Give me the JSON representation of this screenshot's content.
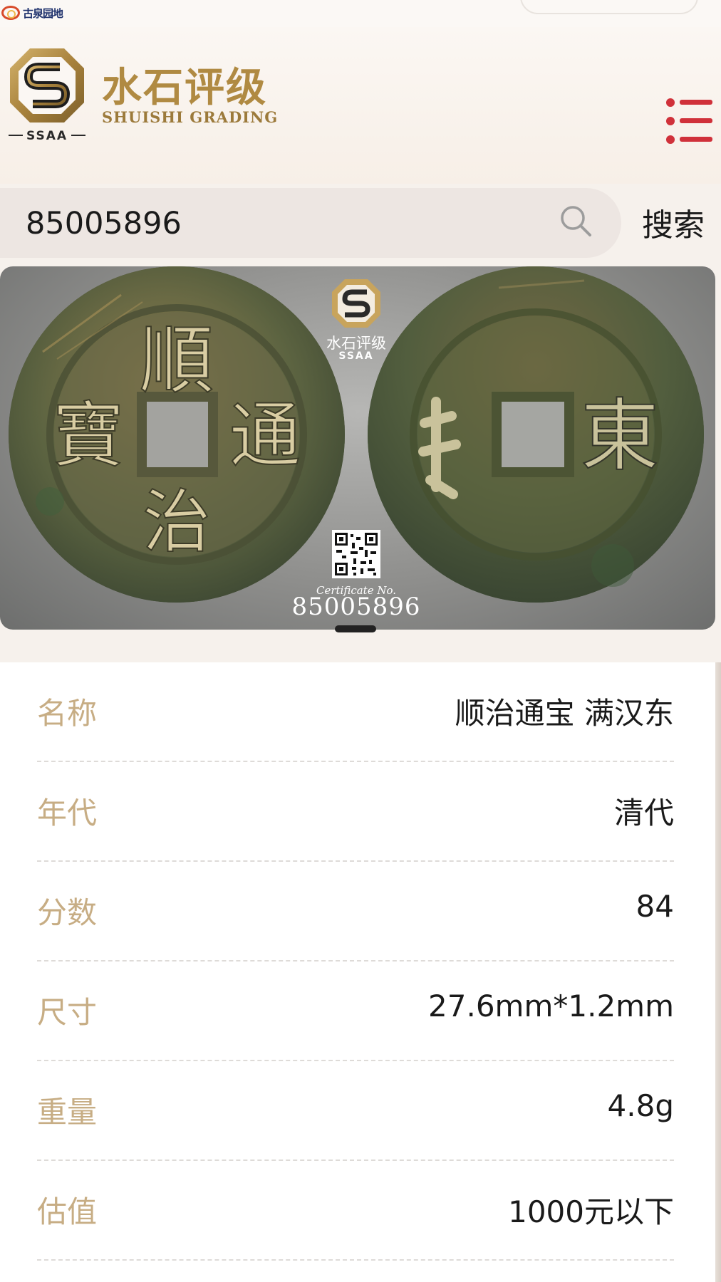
{
  "watermark": {
    "text": "古泉园地"
  },
  "brand": {
    "name_cn": "水石评级",
    "name_en": "SHUISHI GRADING",
    "abbr": "SSAA",
    "gold": "#b08a42"
  },
  "menu": {
    "icon": "list-menu-icon",
    "color": "#d0313a"
  },
  "search": {
    "value": "85005896",
    "button_label": "搜索",
    "icon": "search-icon"
  },
  "coin_image": {
    "logo_cn": "水石评级",
    "logo_en": "SSAA",
    "certificate_label": "Certificate No.",
    "certificate_number": "85005896",
    "obverse_chars": {
      "top": "順",
      "bottom": "治",
      "right": "通",
      "left": "寶"
    },
    "reverse_chars": {
      "right": "東"
    }
  },
  "details": {
    "label_color": "#c7ad84",
    "rows": [
      {
        "label": "名称",
        "value": "顺治通宝 满汉东"
      },
      {
        "label": "年代",
        "value": "清代"
      },
      {
        "label": "分数",
        "value": "84"
      },
      {
        "label": "尺寸",
        "value": "27.6mm*1.2mm"
      },
      {
        "label": "重量",
        "value": "4.8g"
      },
      {
        "label": "估值",
        "value": "1000元以下"
      }
    ]
  }
}
